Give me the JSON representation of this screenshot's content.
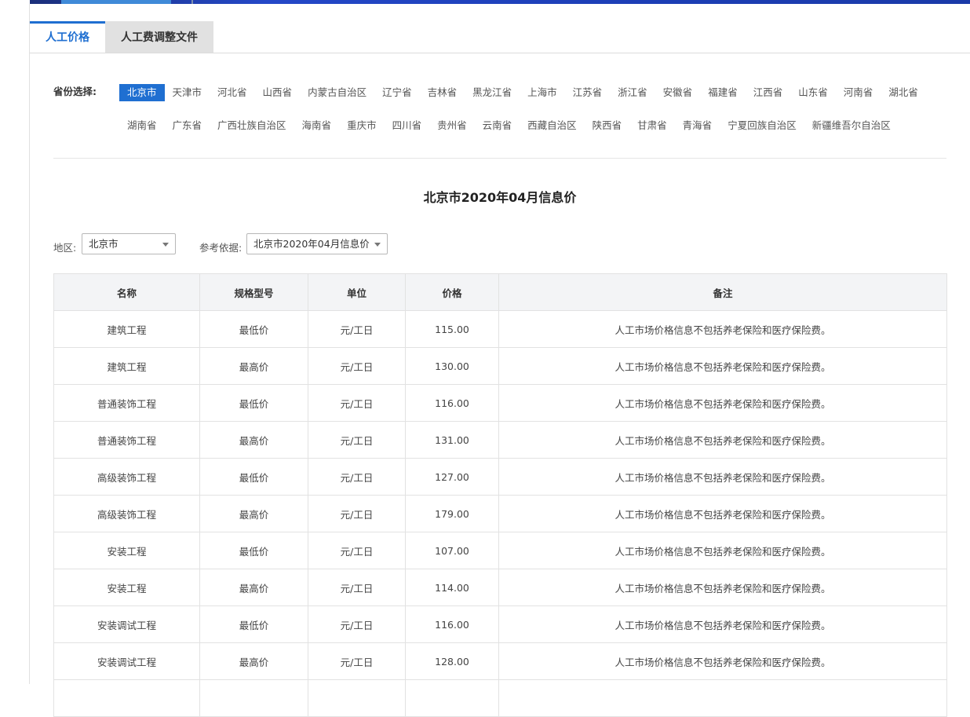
{
  "tabs": [
    {
      "label": "人工价格",
      "active": true
    },
    {
      "label": "人工费调整文件",
      "active": false
    }
  ],
  "province_selector": {
    "label": "省份选择:",
    "selected": "北京市",
    "row1": [
      "北京市",
      "天津市",
      "河北省",
      "山西省",
      "内蒙古自治区",
      "辽宁省",
      "吉林省",
      "黑龙江省",
      "上海市",
      "江苏省",
      "浙江省",
      "安徽省",
      "福建省",
      "江西省",
      "山东省",
      "河南省",
      "湖北省"
    ],
    "row2": [
      "湖南省",
      "广东省",
      "广西壮族自治区",
      "海南省",
      "重庆市",
      "四川省",
      "贵州省",
      "云南省",
      "西藏自治区",
      "陕西省",
      "甘肃省",
      "青海省",
      "宁夏回族自治区",
      "新疆维吾尔自治区"
    ]
  },
  "page_title": "北京市2020年04月信息价",
  "filters": {
    "region_label": "地区:",
    "region_value": "北京市",
    "reference_label": "参考依据:",
    "reference_value": "北京市2020年04月信息价"
  },
  "table": {
    "headers": [
      "名称",
      "规格型号",
      "单位",
      "价格",
      "备注"
    ],
    "rows": [
      [
        "建筑工程",
        "最低价",
        "元/工日",
        "115.00",
        "人工市场价格信息不包括养老保险和医疗保险费。"
      ],
      [
        "建筑工程",
        "最高价",
        "元/工日",
        "130.00",
        "人工市场价格信息不包括养老保险和医疗保险费。"
      ],
      [
        "普通装饰工程",
        "最低价",
        "元/工日",
        "116.00",
        "人工市场价格信息不包括养老保险和医疗保险费。"
      ],
      [
        "普通装饰工程",
        "最高价",
        "元/工日",
        "131.00",
        "人工市场价格信息不包括养老保险和医疗保险费。"
      ],
      [
        "高级装饰工程",
        "最低价",
        "元/工日",
        "127.00",
        "人工市场价格信息不包括养老保险和医疗保险费。"
      ],
      [
        "高级装饰工程",
        "最高价",
        "元/工日",
        "179.00",
        "人工市场价格信息不包括养老保险和医疗保险费。"
      ],
      [
        "安装工程",
        "最低价",
        "元/工日",
        "107.00",
        "人工市场价格信息不包括养老保险和医疗保险费。"
      ],
      [
        "安装工程",
        "最高价",
        "元/工日",
        "114.00",
        "人工市场价格信息不包括养老保险和医疗保险费。"
      ],
      [
        "安装调试工程",
        "最低价",
        "元/工日",
        "116.00",
        "人工市场价格信息不包括养老保险和医疗保险费。"
      ],
      [
        "安装调试工程",
        "最高价",
        "元/工日",
        "128.00",
        "人工市场价格信息不包括养老保险和医疗保险费。"
      ],
      [
        "",
        "",
        "",
        "",
        ""
      ]
    ]
  },
  "colors": {
    "accent": "#1f6fd1",
    "header_bg": "#f3f4f6",
    "inactive_tab_bg": "#e1e1e1"
  }
}
